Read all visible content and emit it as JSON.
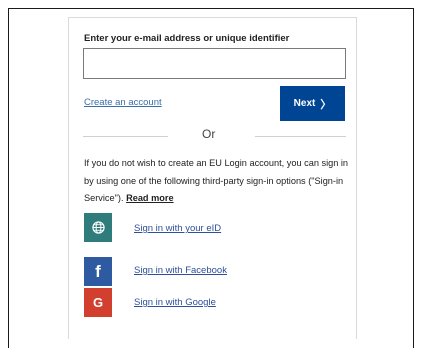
{
  "login": {
    "email_label": "Enter your e-mail address or unique identifier",
    "email_value": "",
    "create_account": "Create an account",
    "next_label": "Next",
    "next_chevron": "〉",
    "or_text": "Or",
    "info_text": "If you do not wish to create an EU Login account, you can sign in by using one of the following third-party sign-in options (\"Sign-in Service\").",
    "read_more": "Read more"
  },
  "providers": [
    {
      "label": "Sign in with your eID",
      "icon": "globe-icon",
      "color": "#2e7d7c"
    },
    {
      "label": "Sign in with Facebook",
      "icon": "facebook-icon",
      "glyph": "f",
      "color": "#2d5aa0"
    },
    {
      "label": "Sign in with Google",
      "icon": "google-icon",
      "glyph": "G",
      "color": "#d23f2f"
    }
  ],
  "colors": {
    "primary_button": "#004494",
    "link": "#3a6ea8"
  }
}
